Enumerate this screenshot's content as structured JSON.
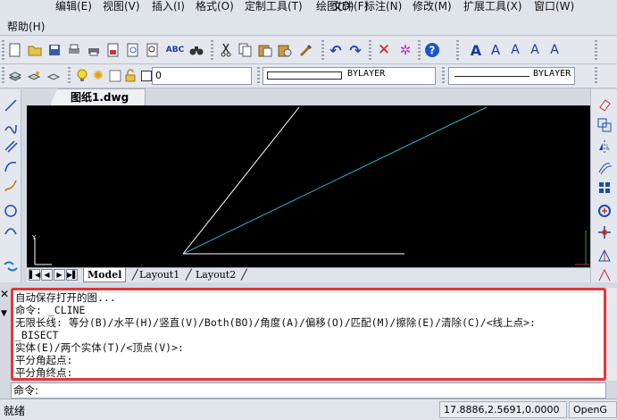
{
  "menubar": {
    "items": [
      "文件(F)",
      "编辑(E)",
      "视图(V)",
      "插入(I)",
      "格式(O)",
      "定制工具(T)",
      "绘图(D)",
      "标注(N)",
      "修改(M)",
      "扩展工具(X)",
      "窗口(W)",
      "帮助(H)"
    ]
  },
  "toolbar2": {
    "layer_name": "0",
    "linetype": "BYLAYER",
    "lineweight": "BYLAYER"
  },
  "document": {
    "tab_title": "图纸1.dwg"
  },
  "layout_tabs": [
    "Model",
    "Layout1",
    "Layout2"
  ],
  "command": {
    "history": [
      "自动保存打开的图...",
      "命令:  _CLINE",
      "无限长线:  等分(B)/水平(H)/竖直(V)/Both(BO)/角度(A)/偏移(O)/匹配(M)/擦除(E)/清除(C)/<线上点>:",
      "_BISECT",
      "实体(E)/两个实体(T)/<顶点(V)>:",
      "平分角起点:",
      "平分角终点:"
    ],
    "prompt": "命令:"
  },
  "status": {
    "ready": "就绪",
    "coordinates": "17.8886,2.5691,0.0000",
    "renderer": "OpenG"
  },
  "colors": {
    "canvas_bg": "#000000",
    "line_white": "#ffffff",
    "line_cyan": "#29b6d4",
    "highlight_border": "#e8343b",
    "axis_green": "#3c9a3c"
  }
}
